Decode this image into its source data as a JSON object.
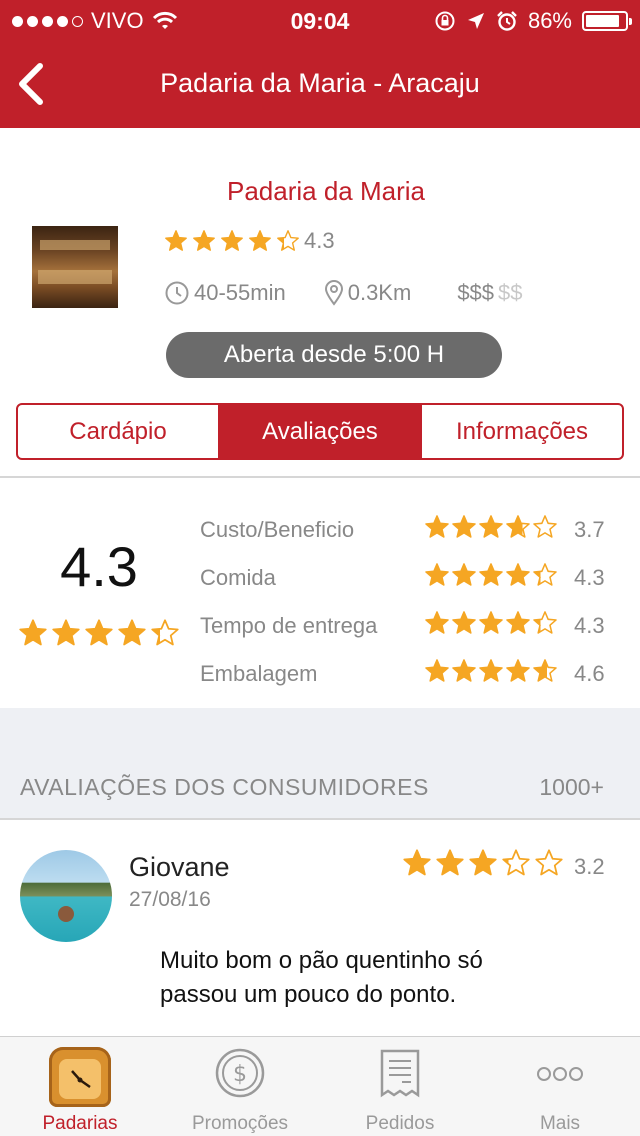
{
  "status_bar": {
    "carrier": "VIVO",
    "time": "09:04",
    "battery": "86%",
    "battery_level": 0.86,
    "signal_bars_filled": 4,
    "signal_bars_total": 5
  },
  "nav": {
    "title": "Padaria da Maria - Aracaju",
    "back_icon": "chevron-left-icon"
  },
  "shop": {
    "name": "Padaria da Maria",
    "rating": "4.3",
    "rating_value": 4.3,
    "delivery_time": "40-55min",
    "distance": "0.3Km",
    "price_active": "$$$",
    "price_inactive": "$$",
    "open_status": "Aberta desde 5:00 H"
  },
  "tabs": [
    {
      "label": "Cardápio",
      "active": false
    },
    {
      "label": "Avaliações",
      "active": true
    },
    {
      "label": "Informações",
      "active": false
    }
  ],
  "ratings": {
    "overall": "4.3",
    "overall_value": 4.3,
    "criteria": [
      {
        "label": "Custo/Beneficio",
        "value": "3.7",
        "score": 3.7
      },
      {
        "label": "Comida",
        "value": "4.3",
        "score": 4.3
      },
      {
        "label": "Tempo de entrega",
        "value": "4.3",
        "score": 4.3
      },
      {
        "label": "Embalagem",
        "value": "4.6",
        "score": 4.6
      }
    ]
  },
  "reviews_section": {
    "title": "AVALIAÇÕES DOS CONSUMIDORES",
    "count": "1000+"
  },
  "reviews": [
    {
      "name": "Giovane",
      "date": "27/08/16",
      "rating": "3.2",
      "score": 3.2,
      "text": "Muito bom o pão quentinho só passou um pouco do ponto."
    }
  ],
  "tab_bar": [
    {
      "label": "Padarias",
      "icon": "toast-clock-icon",
      "active": true
    },
    {
      "label": "Promoções",
      "icon": "coin-dollar-icon",
      "active": false
    },
    {
      "label": "Pedidos",
      "icon": "receipt-icon",
      "active": false
    },
    {
      "label": "Mais",
      "icon": "more-dots-icon",
      "active": false
    }
  ],
  "colors": {
    "brand": "#c0202a",
    "star": "#f5a623",
    "muted": "#888888"
  }
}
